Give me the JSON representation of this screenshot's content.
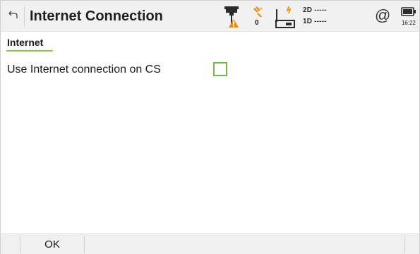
{
  "header": {
    "title": "Internet Connection",
    "back_icon": "back-arrow-icon",
    "status": {
      "satellite_count": "0",
      "quality_2d": "2D -----",
      "quality_1d": "1D -----",
      "connection_icon": "at-sign-icon",
      "battery_time": "16:22"
    }
  },
  "section": {
    "tab_label": "Internet"
  },
  "options": {
    "use_internet_label": "Use Internet connection on CS",
    "use_internet_checked": false
  },
  "footer": {
    "ok_label": "OK"
  },
  "colors": {
    "accent_green": "#6abd45",
    "warning_orange": "#f08c00"
  }
}
